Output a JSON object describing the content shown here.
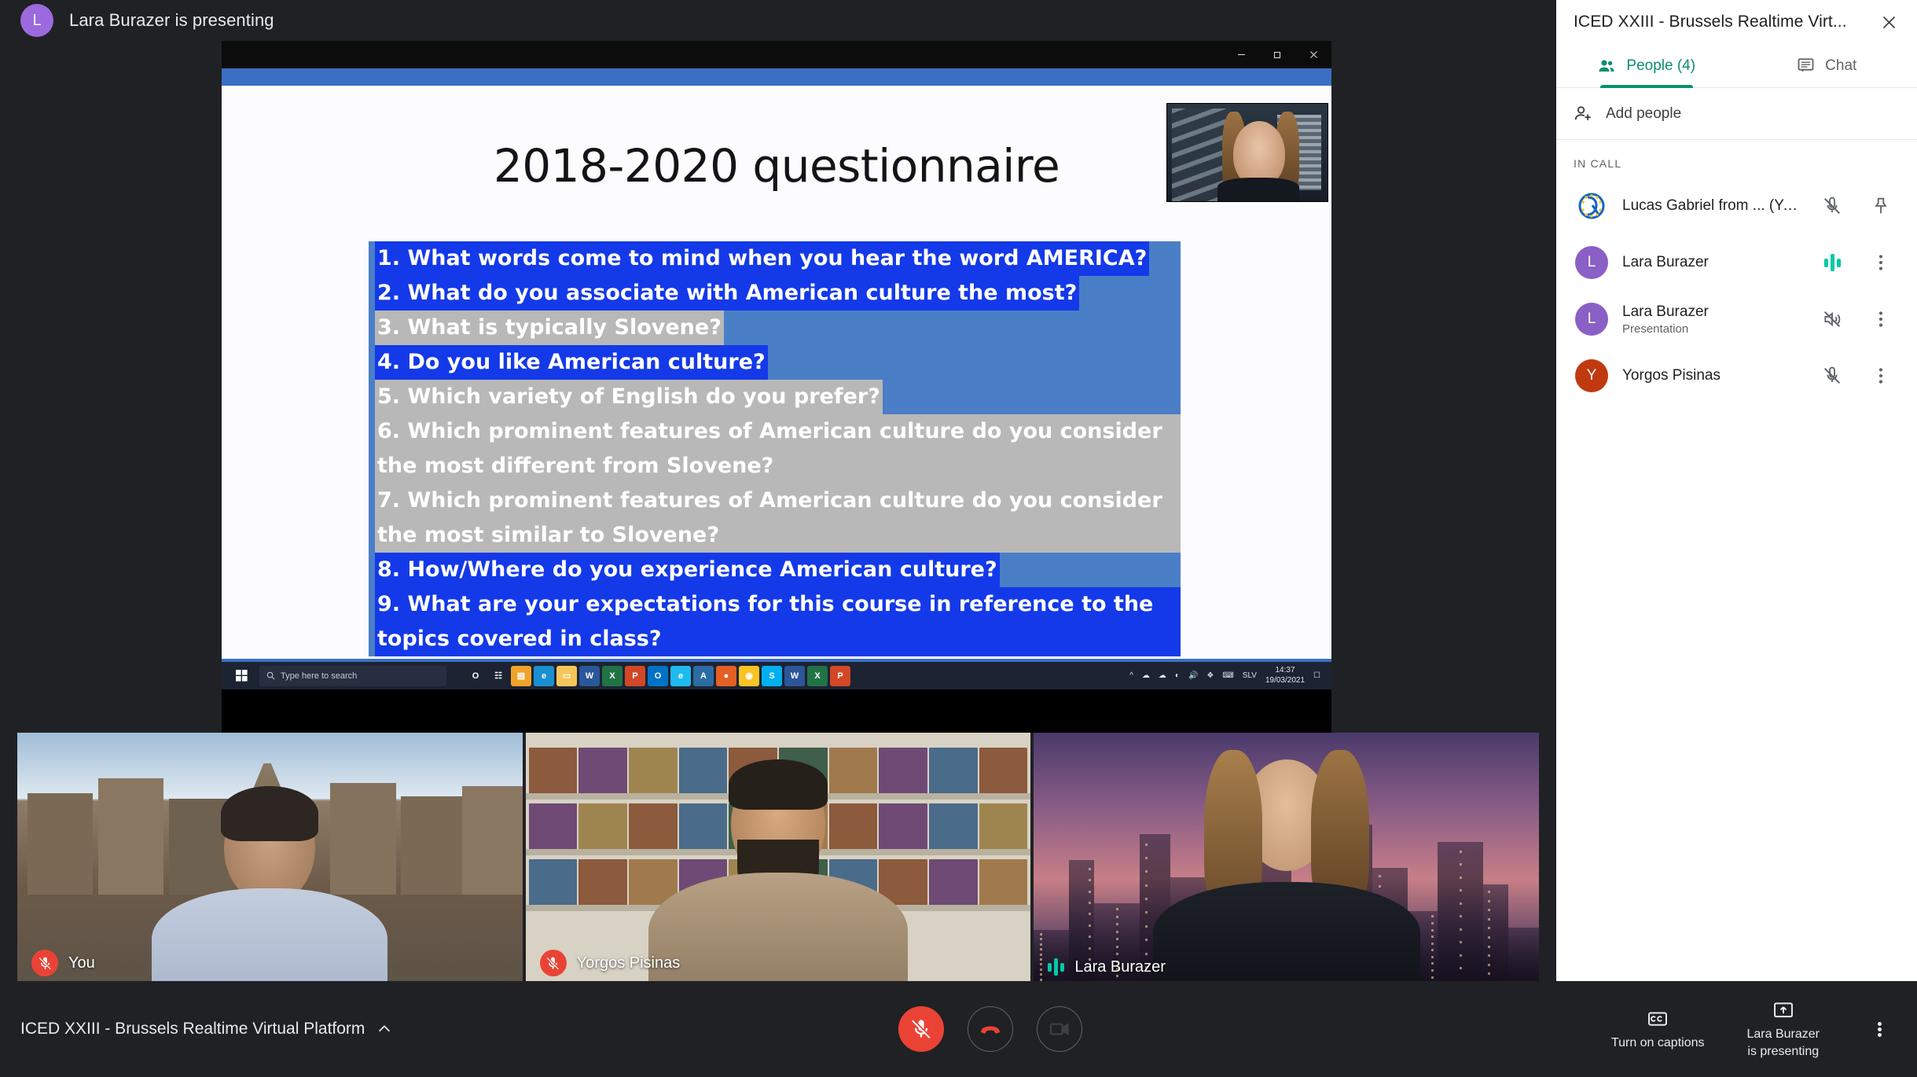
{
  "banner": {
    "avatar_initial": "L",
    "avatar_color": "#9c6ade",
    "text": "Lara Burazer is presenting"
  },
  "shared_screen": {
    "window_controls": {
      "minimize": "minimize-icon",
      "restore": "restore-icon",
      "close": "close-icon"
    },
    "slide": {
      "title": "2018-2020 questionnaire",
      "questions": [
        {
          "text": "1. What words come to mind when you hear the word AMERICA?",
          "selection": "blue"
        },
        {
          "text": "2. What do you associate with American culture the most?",
          "selection": "blue"
        },
        {
          "text": "3. What is typically Slovene?",
          "selection": "gray"
        },
        {
          "text": "4. Do you like American culture?",
          "selection": "blue"
        },
        {
          "text": "5. Which variety of English do you prefer?",
          "selection": "gray"
        },
        {
          "text": "6. Which prominent features of American culture do you consider the most different from Slovene?",
          "selection": "gray"
        },
        {
          "text": "7. Which prominent features of American culture do you consider the most similar to Slovene?",
          "selection": "gray"
        },
        {
          "text": "8. How/Where do you experience American culture?",
          "selection": "blue"
        },
        {
          "text": "9. What are your expectations for this course in reference to the topics covered in class?",
          "selection": "blue"
        }
      ]
    },
    "taskbar": {
      "search_placeholder": "Type here to search",
      "start_icon": "windows-start-icon",
      "apps": [
        {
          "name": "cortana-icon",
          "glyph": "O",
          "color": "#1c2333"
        },
        {
          "name": "task-view-icon",
          "glyph": "☷",
          "color": "#1c2333"
        },
        {
          "name": "store-icon",
          "glyph": "▤",
          "color": "#f0a32a"
        },
        {
          "name": "edge-icon",
          "glyph": "e",
          "color": "#1b8fd0"
        },
        {
          "name": "file-explorer-icon",
          "glyph": "▭",
          "color": "#f6c65b"
        },
        {
          "name": "word-icon",
          "glyph": "W",
          "color": "#2b579a"
        },
        {
          "name": "excel-icon",
          "glyph": "X",
          "color": "#217346"
        },
        {
          "name": "powerpoint-icon",
          "glyph": "P",
          "color": "#d24726"
        },
        {
          "name": "outlook-icon",
          "glyph": "O",
          "color": "#0072c6"
        },
        {
          "name": "internet-explorer-icon",
          "glyph": "e",
          "color": "#1ebbee"
        },
        {
          "name": "adobe-reader-icon",
          "glyph": "A",
          "color": "#2b6ca3"
        },
        {
          "name": "firefox-icon",
          "glyph": "●",
          "color": "#e45f23"
        },
        {
          "name": "chrome-icon",
          "glyph": "◉",
          "color": "#f7c325"
        },
        {
          "name": "skype-icon",
          "glyph": "S",
          "color": "#00aff0"
        },
        {
          "name": "word-doc-icon",
          "glyph": "W",
          "color": "#2b579a"
        },
        {
          "name": "excel-doc-icon",
          "glyph": "X",
          "color": "#217346"
        },
        {
          "name": "powerpoint-active-icon",
          "glyph": "P",
          "color": "#d24726"
        }
      ],
      "tray": [
        {
          "name": "chevron-up-icon",
          "glyph": "⌃"
        },
        {
          "name": "onedrive-business-icon",
          "glyph": "☁"
        },
        {
          "name": "onedrive-icon",
          "glyph": "☁"
        },
        {
          "name": "wifi-icon",
          "glyph": "◠"
        },
        {
          "name": "volume-icon",
          "glyph": "ὐA"
        },
        {
          "name": "dropbox-icon",
          "glyph": "❖"
        },
        {
          "name": "keyboard-icon",
          "glyph": "⌨"
        }
      ],
      "language": "SLV",
      "time": "14:37",
      "date": "19/03/2021",
      "action_center_icon": "notification-icon"
    }
  },
  "tiles": [
    {
      "name": "You",
      "mic": "muted",
      "background": "brussels-grand-place"
    },
    {
      "name": "Yorgos Pisinas",
      "mic": "muted",
      "background": "bookshelf"
    },
    {
      "name": "Lara Burazer",
      "mic": "speaking",
      "background": "city-skyline"
    }
  ],
  "sidebar": {
    "title": "ICED XXIII - Brussels Realtime Virt...",
    "close_icon": "close-icon",
    "tabs": [
      {
        "label": "People (4)",
        "icon": "people-icon",
        "active": true
      },
      {
        "label": "Chat",
        "icon": "chat-icon",
        "active": false
      }
    ],
    "add_people": {
      "label": "Add people",
      "icon": "add-person-icon"
    },
    "section_label": "IN CALL",
    "participants": [
      {
        "name": "Lucas Gabriel from ... (You)",
        "sub": "",
        "avatar_type": "logo",
        "avatar_initial": "",
        "avatar_color": "#ffffff",
        "mic_icon": "mic-off-icon",
        "action_icon": "pin-icon"
      },
      {
        "name": "Lara Burazer",
        "sub": "",
        "avatar_type": "initial",
        "avatar_initial": "L",
        "avatar_color": "#8a5fc6",
        "mic_icon": "audio-level-icon",
        "action_icon": "more-icon"
      },
      {
        "name": "Lara Burazer",
        "sub": "Presentation",
        "avatar_type": "initial",
        "avatar_initial": "L",
        "avatar_color": "#8a5fc6",
        "mic_icon": "speaker-off-icon",
        "action_icon": "more-icon"
      },
      {
        "name": "Yorgos Pisinas",
        "sub": "",
        "avatar_type": "initial",
        "avatar_initial": "Y",
        "avatar_color": "#c0390f",
        "mic_icon": "mic-off-icon",
        "action_icon": "more-icon"
      }
    ]
  },
  "bottom_bar": {
    "meeting_name": "ICED XXIII - Brussels Realtime Virtual Platform",
    "expand_icon": "chevron-up-icon",
    "controls": [
      {
        "name": "microphone-button",
        "icon": "mic-off-icon",
        "state": "muted"
      },
      {
        "name": "hangup-button",
        "icon": "hangup-icon",
        "state": "default"
      },
      {
        "name": "camera-button",
        "icon": "camera-icon",
        "state": "default"
      }
    ],
    "captions": {
      "label": "Turn on captions",
      "icon": "closed-captions-icon"
    },
    "present": {
      "label_line1": "Lara Burazer",
      "label_line2": "is presenting",
      "icon": "present-screen-icon"
    },
    "more_icon": "more-vertical-icon"
  }
}
